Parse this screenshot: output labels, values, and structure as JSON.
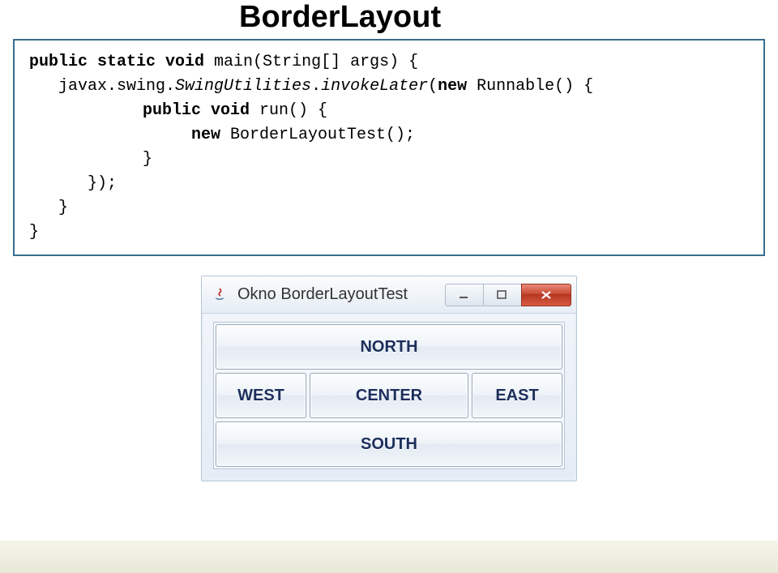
{
  "slide": {
    "title": "BorderLayout"
  },
  "code": {
    "line1_pre": "public static void",
    "line1_post": " main(String[] args) {",
    "line2_pre": "javax.swing.",
    "line2_mid": "SwingUtilities",
    "line2_post": ".",
    "line2_invoke": "invokeLater",
    "line2_open": "(",
    "line2_new": "new",
    "line2_runnable": " Runnable() {",
    "line3_pre": "public void",
    "line3_post": " run() {",
    "line4_new": "new",
    "line4_post": " BorderLayoutTest();",
    "line5": "}",
    "line6": "});",
    "line7": "}",
    "line8": "}"
  },
  "window": {
    "title": "Okno BorderLayoutTest",
    "buttons": {
      "north": "NORTH",
      "south": "SOUTH",
      "west": "WEST",
      "center": "CENTER",
      "east": "EAST"
    }
  }
}
